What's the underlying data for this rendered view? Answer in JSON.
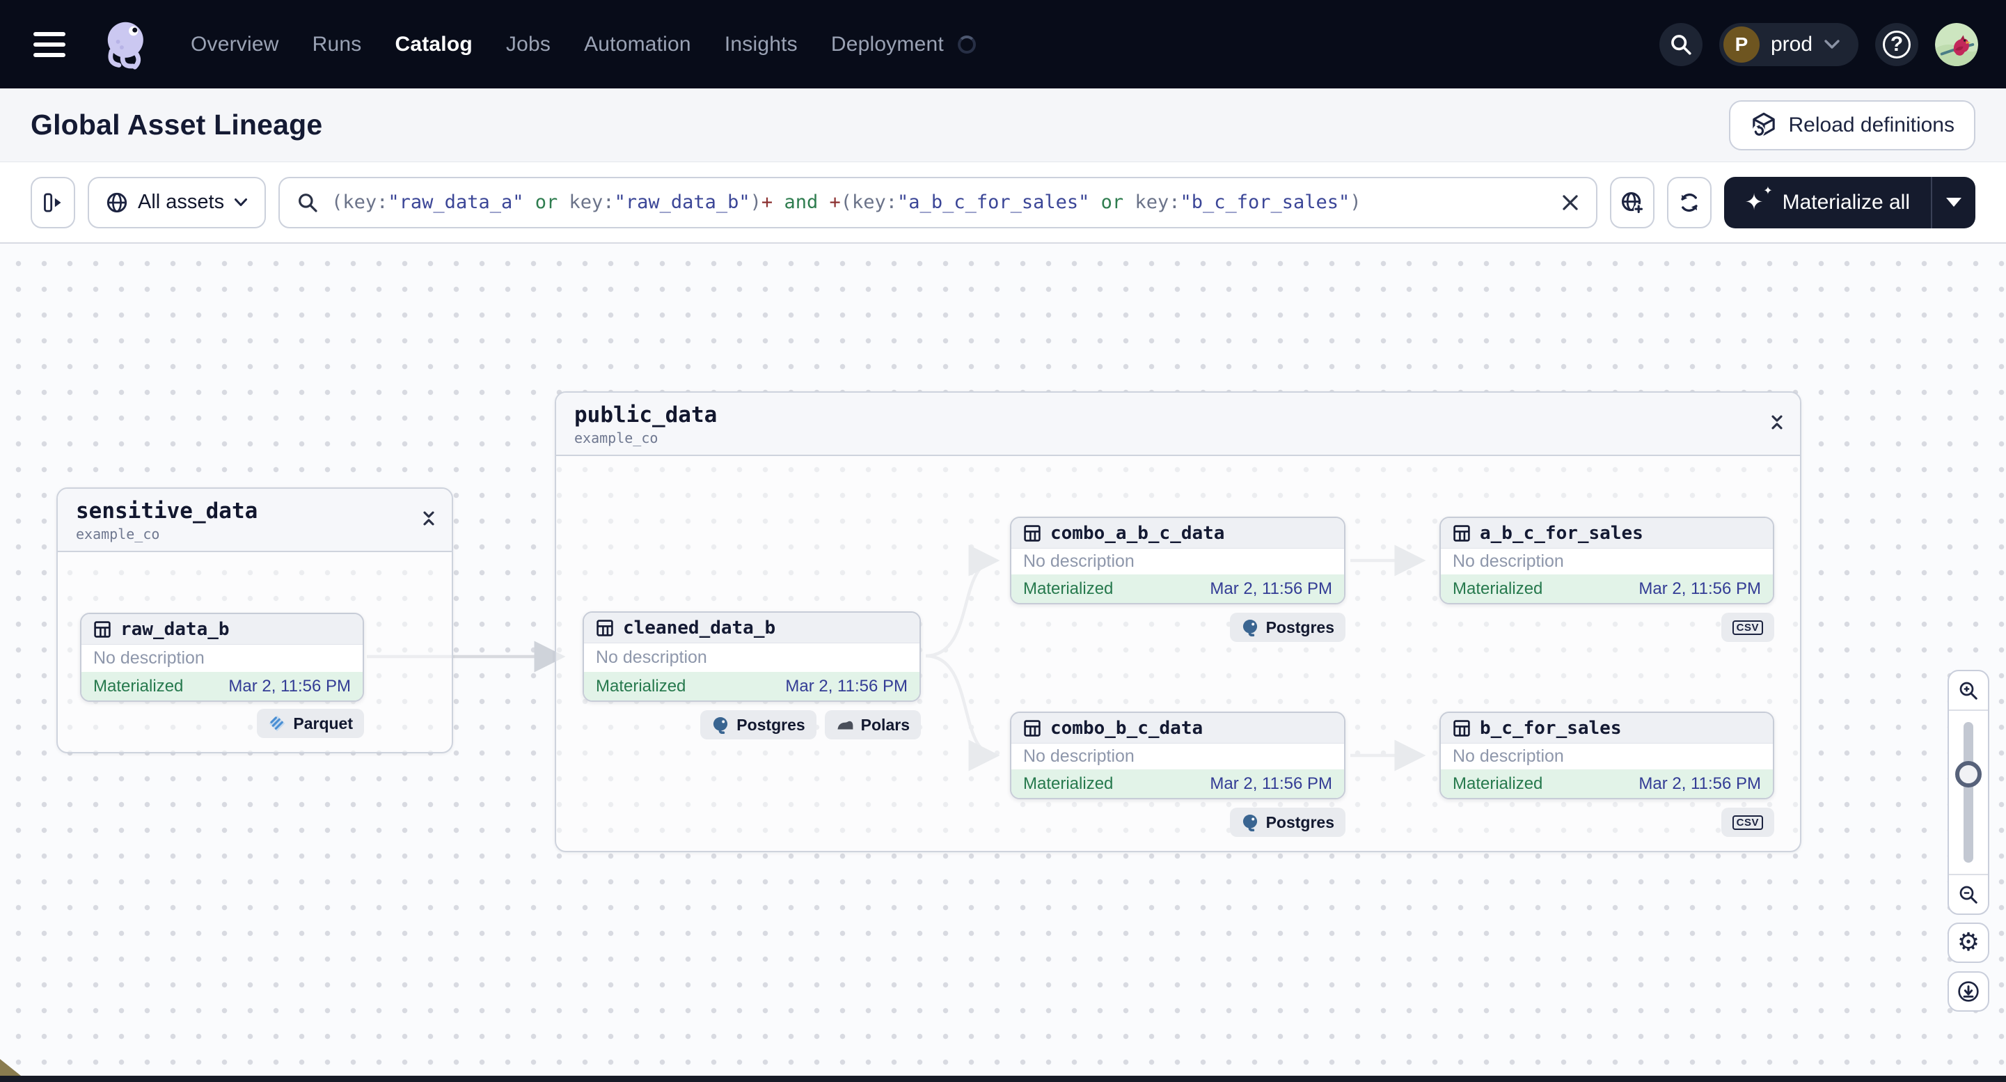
{
  "nav": {
    "links": [
      {
        "label": "Overview"
      },
      {
        "label": "Runs"
      },
      {
        "label": "Catalog"
      },
      {
        "label": "Jobs"
      },
      {
        "label": "Automation"
      },
      {
        "label": "Insights"
      },
      {
        "label": "Deployment"
      }
    ],
    "active_link": "Catalog",
    "environment": {
      "initial": "P",
      "name": "prod"
    }
  },
  "header": {
    "title": "Global Asset Lineage",
    "reload_button": "Reload definitions"
  },
  "toolbar": {
    "scope_button": "All assets",
    "materialize_button": "Materialize all",
    "query_segments": [
      {
        "t": "(",
        "c": "punct"
      },
      {
        "t": "key:",
        "c": "punct"
      },
      {
        "t": "\"raw_data_a\"",
        "c": "str"
      },
      {
        "t": " ",
        "c": "punct"
      },
      {
        "t": "or",
        "c": "op"
      },
      {
        "t": " ",
        "c": "punct"
      },
      {
        "t": "key:",
        "c": "punct"
      },
      {
        "t": "\"raw_data_b\"",
        "c": "str"
      },
      {
        "t": ")",
        "c": "punct"
      },
      {
        "t": "+",
        "c": "plus"
      },
      {
        "t": " ",
        "c": "punct"
      },
      {
        "t": "and",
        "c": "op"
      },
      {
        "t": " ",
        "c": "punct"
      },
      {
        "t": "+",
        "c": "plus"
      },
      {
        "t": "(",
        "c": "punct"
      },
      {
        "t": "key:",
        "c": "punct"
      },
      {
        "t": "\"a_b_c_for_sales\"",
        "c": "str"
      },
      {
        "t": " ",
        "c": "punct"
      },
      {
        "t": "or",
        "c": "op"
      },
      {
        "t": " ",
        "c": "punct"
      },
      {
        "t": "key:",
        "c": "punct"
      },
      {
        "t": "\"b_c_for_sales\"",
        "c": "str"
      },
      {
        "t": ")",
        "c": "punct"
      }
    ]
  },
  "graph": {
    "groups": [
      {
        "title": "sensitive_data",
        "subtitle": "example_co"
      },
      {
        "title": "public_data",
        "subtitle": "example_co"
      }
    ],
    "nodes": [
      {
        "name": "raw_data_b",
        "description": "No description",
        "status": "Materialized",
        "timestamp": "Mar 2, 11:56 PM"
      },
      {
        "name": "cleaned_data_b",
        "description": "No description",
        "status": "Materialized",
        "timestamp": "Mar 2, 11:56 PM"
      },
      {
        "name": "combo_a_b_c_data",
        "description": "No description",
        "status": "Materialized",
        "timestamp": "Mar 2, 11:56 PM"
      },
      {
        "name": "a_b_c_for_sales",
        "description": "No description",
        "status": "Materialized",
        "timestamp": "Mar 2, 11:56 PM"
      },
      {
        "name": "combo_b_c_data",
        "description": "No description",
        "status": "Materialized",
        "timestamp": "Mar 2, 11:56 PM"
      },
      {
        "name": "b_c_for_sales",
        "description": "No description",
        "status": "Materialized",
        "timestamp": "Mar 2, 11:56 PM"
      }
    ],
    "badges": {
      "parquet": "Parquet",
      "postgres": "Postgres",
      "polars": "Polars",
      "csv": "CSV"
    }
  },
  "colors": {
    "nav_bg": "#080c19",
    "status_green": "#26794d",
    "timestamp_indigo": "#333c95",
    "query_string": "#3b4697",
    "query_operator": "#2f7d4f",
    "query_plus": "#8c3131",
    "materialized_row_bg": "#e2f3e8"
  }
}
